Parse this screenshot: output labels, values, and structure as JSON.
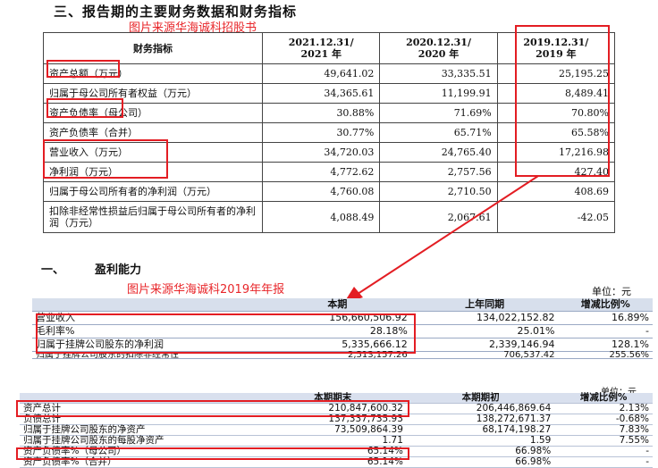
{
  "section_title": "三、报告期的主要财务数据和财务指标",
  "watermark_1": "图片来源华海诚科招股书",
  "table1": {
    "headers": [
      "财务指标",
      "2021.12.31/\n2021 年",
      "2020.12.31/\n2020 年",
      "2019.12.31/\n2019 年"
    ],
    "rows": [
      [
        "资产总额（万元）",
        "49,641.02",
        "33,335.51",
        "25,195.25"
      ],
      [
        "归属于母公司所有者权益（万元）",
        "34,365.61",
        "11,199.91",
        "8,489.41"
      ],
      [
        "资产负债率（母公司）",
        "30.88%",
        "71.69%",
        "70.80%"
      ],
      [
        "资产负债率（合并）",
        "30.77%",
        "65.71%",
        "65.58%"
      ],
      [
        "营业收入（万元）",
        "34,720.03",
        "24,765.40",
        "17,216.98"
      ],
      [
        "净利润（万元）",
        "4,772.62",
        "2,757.56",
        "427.40"
      ],
      [
        "归属于母公司所有者的净利润（万元）",
        "4,760.08",
        "2,710.50",
        "408.69"
      ],
      [
        "扣除非经常性损益后归属于母公司所有者的净利润（万元）",
        "4,088.49",
        "2,067.61",
        "-42.05"
      ]
    ]
  },
  "section2_num": "一、",
  "section2_title": "盈利能力",
  "watermark_2": "图片来源华海诚科2019年年报",
  "unit_label_2": "单位：元",
  "table2": {
    "headers": [
      "",
      "本期",
      "上年同期",
      "增减比例%"
    ],
    "rows": [
      [
        "营业收入",
        "156,660,506.92",
        "134,022,152.82",
        "16.89%"
      ],
      [
        "毛利率%",
        "28.18%",
        "25.01%",
        "-"
      ],
      [
        "归属于挂牌公司股东的净利润",
        "5,335,666.12",
        "2,339,146.94",
        "128.1%"
      ],
      [
        "归属于挂牌公司股东的扣除非经常性",
        "2,513,157.26",
        "706,537.42",
        "255.56%"
      ]
    ]
  },
  "unit_label_3": "单位：元",
  "table3": {
    "headers": [
      "",
      "本期期末",
      "本期期初",
      "增减比例%"
    ],
    "rows": [
      [
        "资产总计",
        "210,847,600.32",
        "206,446,869.64",
        "2.13%"
      ],
      [
        "负债总计",
        "137,337,735.93",
        "138,272,671.37",
        "-0.68%"
      ],
      [
        "归属于挂牌公司股东的净资产",
        "73,509,864.39",
        "68,174,198.27",
        "7.83%"
      ],
      [
        "归属于挂牌公司股东的每股净资产",
        "1.71",
        "1.59",
        "7.55%"
      ],
      [
        "资产负债率%（母公司）",
        "65.14%",
        "66.98%",
        "-"
      ],
      [
        "资产负债率%（合并）",
        "65.14%",
        "66.98%",
        "-"
      ]
    ]
  },
  "colors": {
    "highlight": "#e31d23",
    "watermark": "#e8262a",
    "header_fill": "#d7dfec"
  }
}
